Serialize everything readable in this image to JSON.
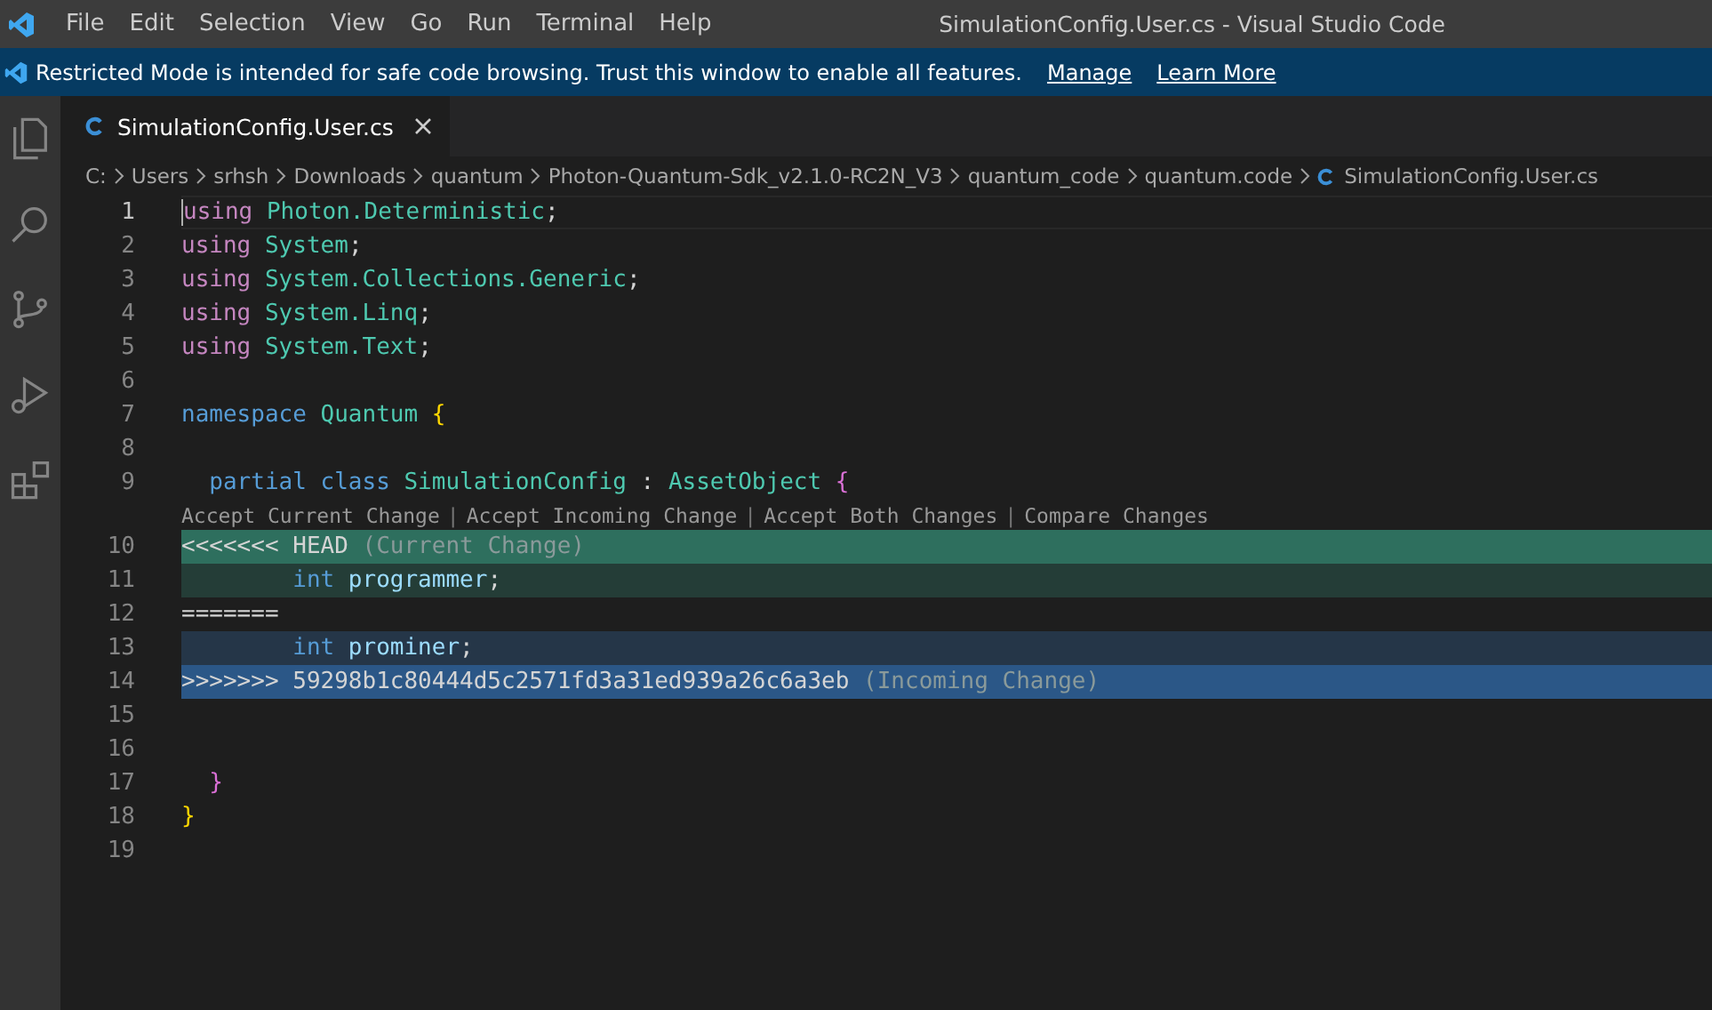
{
  "menu": [
    "File",
    "Edit",
    "Selection",
    "View",
    "Go",
    "Run",
    "Terminal",
    "Help"
  ],
  "window": {
    "title": "SimulationConfig.User.cs - Visual Studio Code"
  },
  "banner": {
    "message": "Restricted Mode is intended for safe code browsing. Trust this window to enable all features.",
    "links": [
      "Manage",
      "Learn More"
    ]
  },
  "activity_bar": [
    {
      "kind": "files",
      "selected": false
    },
    {
      "kind": "search",
      "selected": false
    },
    {
      "kind": "scm",
      "selected": false
    },
    {
      "kind": "debug",
      "selected": false
    },
    {
      "kind": "extensions",
      "selected": false
    }
  ],
  "tabs": [
    {
      "label": "SimulationConfig.User.cs",
      "selected": true
    }
  ],
  "breadcrumbs": [
    "C:",
    "Users",
    "srhsh",
    "Downloads",
    "quantum",
    "Photon-Quantum-Sdk_v2.1.0-RC2N_V3",
    "quantum_code",
    "quantum.code",
    "SimulationConfig.User.cs"
  ],
  "lines": [
    {
      "number": "1",
      "active": true,
      "kind": "plain",
      "tokens": [
        {
          "kind": "using",
          "text": "using"
        },
        {
          "kind": "type",
          "text": " Photon.Deterministic"
        },
        {
          "kind": "punct",
          "text": ";"
        }
      ]
    },
    {
      "number": "2",
      "active": false,
      "kind": "plain",
      "tokens": [
        {
          "kind": "using",
          "text": "using"
        },
        {
          "kind": "type",
          "text": " System"
        },
        {
          "kind": "punct",
          "text": ";"
        }
      ]
    },
    {
      "number": "3",
      "active": false,
      "kind": "plain",
      "tokens": [
        {
          "kind": "using",
          "text": "using"
        },
        {
          "kind": "type",
          "text": " System.Collections.Generic"
        },
        {
          "kind": "punct",
          "text": ";"
        }
      ]
    },
    {
      "number": "4",
      "active": false,
      "kind": "plain",
      "tokens": [
        {
          "kind": "using",
          "text": "using"
        },
        {
          "kind": "type",
          "text": " System.Linq"
        },
        {
          "kind": "punct",
          "text": ";"
        }
      ]
    },
    {
      "number": "5",
      "active": false,
      "kind": "plain",
      "tokens": [
        {
          "kind": "using",
          "text": "using"
        },
        {
          "kind": "type",
          "text": " System.Text"
        },
        {
          "kind": "punct",
          "text": ";"
        }
      ]
    },
    {
      "number": "6",
      "active": false,
      "kind": "plain"
    },
    {
      "number": "7",
      "active": false,
      "kind": "plain",
      "tokens": [
        {
          "kind": "keyword",
          "text": "namespace"
        },
        {
          "kind": "type",
          "text": " Quantum"
        },
        {
          "kind": "brace1",
          "text": " {"
        }
      ]
    },
    {
      "number": "8",
      "active": false,
      "kind": "plain"
    },
    {
      "number": "9",
      "active": false,
      "kind": "plain",
      "tokens": [
        {
          "kind": "keyword",
          "text": "  partial class"
        },
        {
          "kind": "type",
          "text": " SimulationConfig"
        },
        {
          "kind": "punct",
          "text": " :"
        },
        {
          "kind": "type",
          "text": " AssetObject"
        },
        {
          "kind": "brace2",
          "text": " {"
        }
      ]
    },
    {
      "number": "10",
      "active": false,
      "kind": "current-header",
      "codelens": [
        {
          "kind": "action",
          "text": "Accept Current Change"
        },
        {
          "kind": "separator",
          "text": "|"
        },
        {
          "kind": "action",
          "text": "Accept Incoming Change"
        },
        {
          "kind": "separator",
          "text": "|"
        },
        {
          "kind": "action",
          "text": "Accept Both Changes"
        },
        {
          "kind": "separator",
          "text": "|"
        },
        {
          "kind": "action",
          "text": "Compare Changes"
        }
      ],
      "tokens": [
        {
          "kind": "marker",
          "text": "<<<<<<< HEAD"
        },
        {
          "kind": "label",
          "text": " (Current Change)"
        }
      ]
    },
    {
      "number": "11",
      "active": false,
      "kind": "current",
      "tokens": [
        {
          "kind": "keyword",
          "text": "        int"
        },
        {
          "kind": "ident",
          "text": " programmer"
        },
        {
          "kind": "punct",
          "text": ";"
        }
      ]
    },
    {
      "number": "12",
      "active": false,
      "kind": "plain",
      "tokens": [
        {
          "kind": "marker",
          "text": "======="
        }
      ]
    },
    {
      "number": "13",
      "active": false,
      "kind": "incoming",
      "tokens": [
        {
          "kind": "keyword",
          "text": "        int"
        },
        {
          "kind": "ident",
          "text": " prominer"
        },
        {
          "kind": "punct",
          "text": ";"
        }
      ]
    },
    {
      "number": "14",
      "active": false,
      "kind": "incoming-header",
      "tokens": [
        {
          "kind": "marker",
          "text": ">>>>>>> 59298b1c80444d5c2571fd3a31ed939a26c6a3eb"
        },
        {
          "kind": "label",
          "text": " (Incoming Change)"
        }
      ]
    },
    {
      "number": "15",
      "active": false,
      "kind": "plain"
    },
    {
      "number": "16",
      "active": false,
      "kind": "plain"
    },
    {
      "number": "17",
      "active": false,
      "kind": "plain",
      "tokens": [
        {
          "kind": "brace2",
          "text": "  }"
        }
      ]
    },
    {
      "number": "18",
      "active": false,
      "kind": "plain",
      "tokens": [
        {
          "kind": "brace1",
          "text": "}"
        }
      ]
    },
    {
      "number": "19",
      "active": false,
      "kind": "plain"
    }
  ]
}
